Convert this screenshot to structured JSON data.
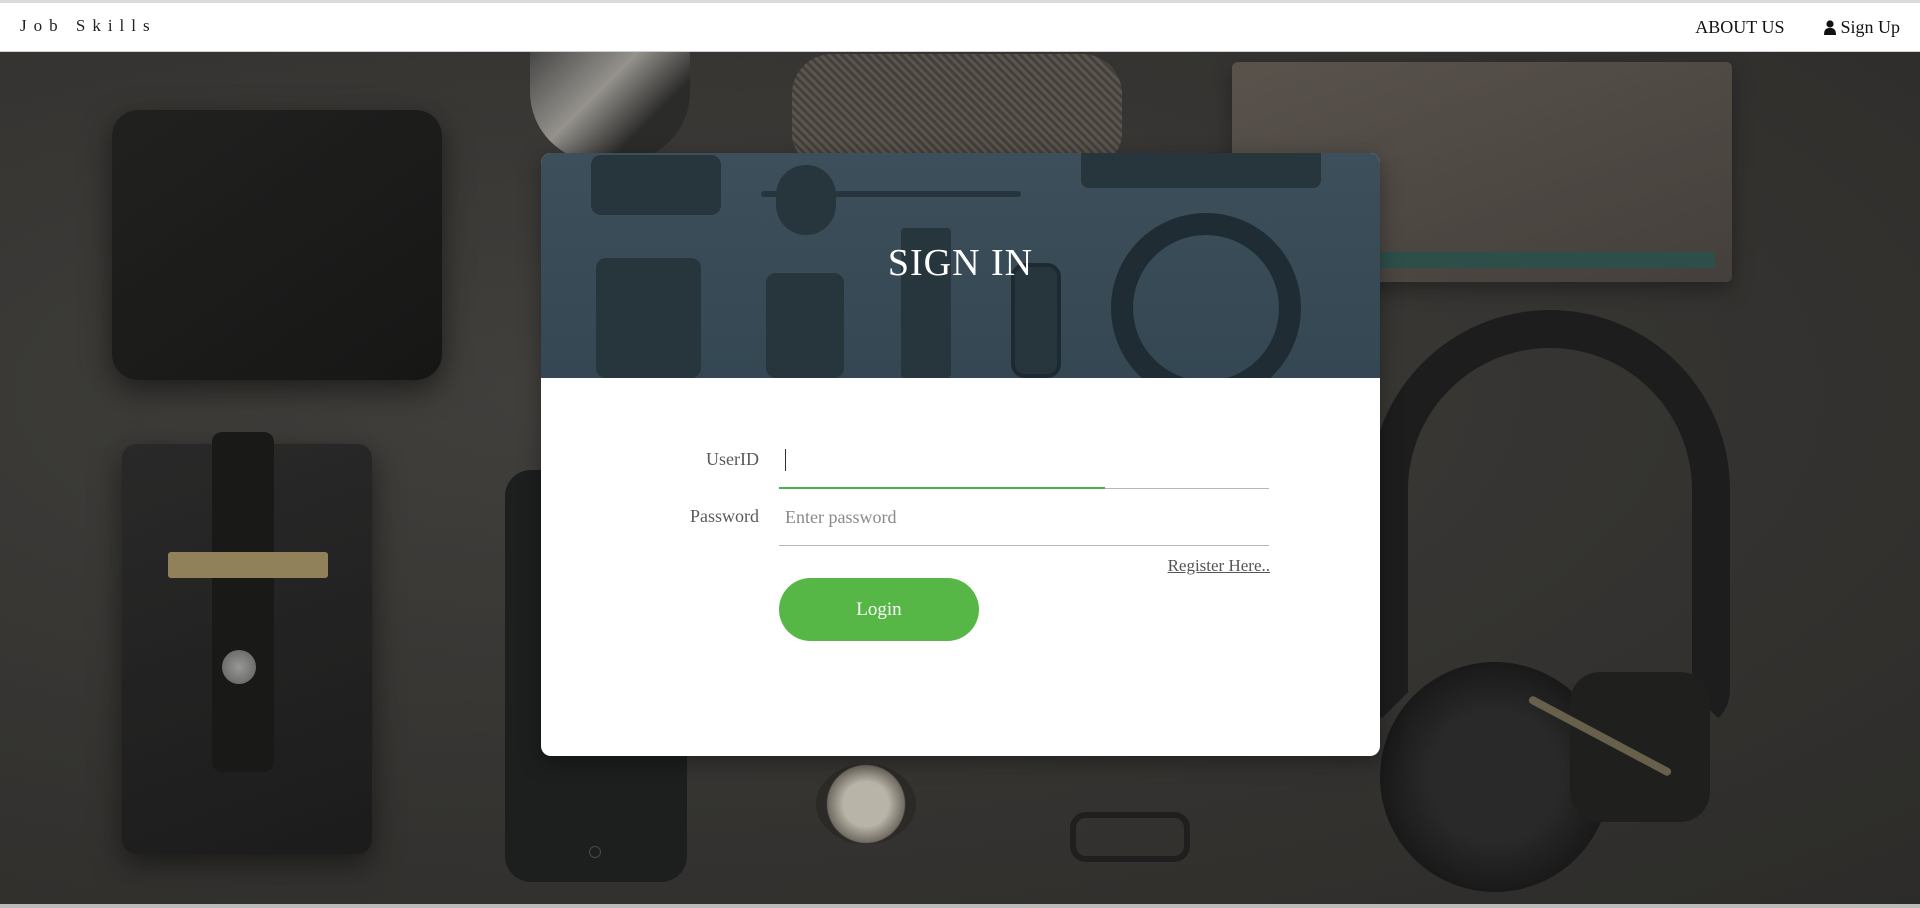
{
  "navbar": {
    "brand": "Job Skills",
    "about_label": "ABOUT US",
    "signup_label": "Sign Up",
    "signup_icon": "user-icon"
  },
  "signin": {
    "title": "SIGN IN",
    "userid_label": "UserID",
    "userid_value": "",
    "password_label": "Password",
    "password_placeholder": "Enter password",
    "password_value": "",
    "register_link": "Register Here..",
    "login_button": "Login"
  },
  "colors": {
    "accent_green": "#56b746",
    "focus_green": "#4cae4c",
    "header_overlay": "#3c4f5b"
  }
}
